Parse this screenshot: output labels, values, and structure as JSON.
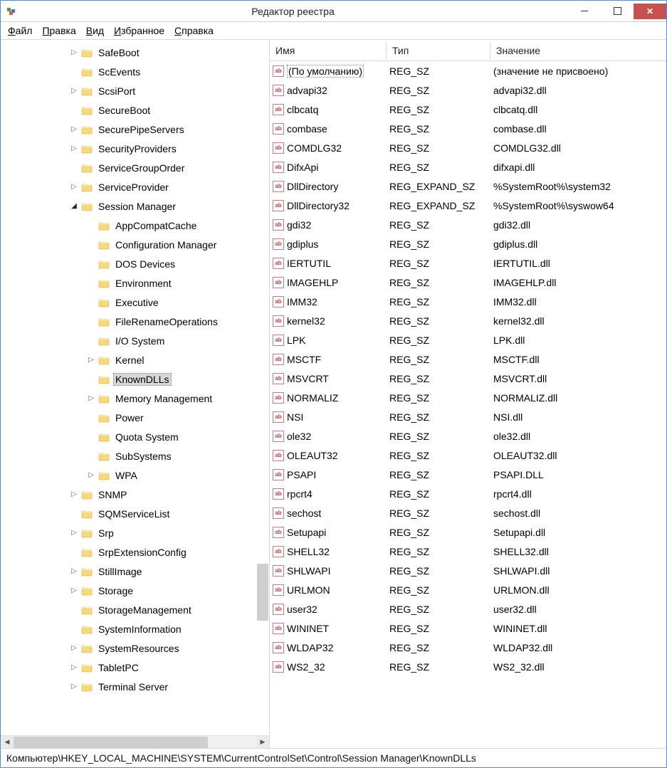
{
  "window": {
    "title": "Редактор реестра"
  },
  "menu": {
    "file": "Файл",
    "edit": "Правка",
    "view": "Вид",
    "favorites": "Избранное",
    "help": "Справка"
  },
  "tree": {
    "items": [
      {
        "indent": 3,
        "exp": "▷",
        "label": "SafeBoot"
      },
      {
        "indent": 3,
        "exp": "",
        "label": "ScEvents"
      },
      {
        "indent": 3,
        "exp": "▷",
        "label": "ScsiPort"
      },
      {
        "indent": 3,
        "exp": "",
        "label": "SecureBoot"
      },
      {
        "indent": 3,
        "exp": "▷",
        "label": "SecurePipeServers"
      },
      {
        "indent": 3,
        "exp": "▷",
        "label": "SecurityProviders"
      },
      {
        "indent": 3,
        "exp": "",
        "label": "ServiceGroupOrder"
      },
      {
        "indent": 3,
        "exp": "▷",
        "label": "ServiceProvider"
      },
      {
        "indent": 3,
        "exp": "◢",
        "label": "Session Manager"
      },
      {
        "indent": 4,
        "exp": "",
        "label": "AppCompatCache"
      },
      {
        "indent": 4,
        "exp": "",
        "label": "Configuration Manager"
      },
      {
        "indent": 4,
        "exp": "",
        "label": "DOS Devices"
      },
      {
        "indent": 4,
        "exp": "",
        "label": "Environment"
      },
      {
        "indent": 4,
        "exp": "",
        "label": "Executive"
      },
      {
        "indent": 4,
        "exp": "",
        "label": "FileRenameOperations"
      },
      {
        "indent": 4,
        "exp": "",
        "label": "I/O System"
      },
      {
        "indent": 4,
        "exp": "▷",
        "label": "Kernel"
      },
      {
        "indent": 4,
        "exp": "",
        "label": "KnownDLLs",
        "selected": true
      },
      {
        "indent": 4,
        "exp": "▷",
        "label": "Memory Management"
      },
      {
        "indent": 4,
        "exp": "",
        "label": "Power"
      },
      {
        "indent": 4,
        "exp": "",
        "label": "Quota System"
      },
      {
        "indent": 4,
        "exp": "",
        "label": "SubSystems"
      },
      {
        "indent": 4,
        "exp": "▷",
        "label": "WPA"
      },
      {
        "indent": 3,
        "exp": "▷",
        "label": "SNMP"
      },
      {
        "indent": 3,
        "exp": "",
        "label": "SQMServiceList"
      },
      {
        "indent": 3,
        "exp": "▷",
        "label": "Srp"
      },
      {
        "indent": 3,
        "exp": "",
        "label": "SrpExtensionConfig"
      },
      {
        "indent": 3,
        "exp": "▷",
        "label": "StillImage"
      },
      {
        "indent": 3,
        "exp": "▷",
        "label": "Storage"
      },
      {
        "indent": 3,
        "exp": "",
        "label": "StorageManagement"
      },
      {
        "indent": 3,
        "exp": "",
        "label": "SystemInformation"
      },
      {
        "indent": 3,
        "exp": "▷",
        "label": "SystemResources"
      },
      {
        "indent": 3,
        "exp": "▷",
        "label": "TabletPC"
      },
      {
        "indent": 3,
        "exp": "▷",
        "label": "Terminal Server"
      }
    ]
  },
  "list": {
    "headers": {
      "name": "Имя",
      "type": "Тип",
      "value": "Значение"
    },
    "rows": [
      {
        "name": "(По умолчанию)",
        "type": "REG_SZ",
        "value": "(значение не присвоено)"
      },
      {
        "name": "advapi32",
        "type": "REG_SZ",
        "value": "advapi32.dll"
      },
      {
        "name": "clbcatq",
        "type": "REG_SZ",
        "value": "clbcatq.dll"
      },
      {
        "name": "combase",
        "type": "REG_SZ",
        "value": "combase.dll"
      },
      {
        "name": "COMDLG32",
        "type": "REG_SZ",
        "value": "COMDLG32.dll"
      },
      {
        "name": "DifxApi",
        "type": "REG_SZ",
        "value": "difxapi.dll"
      },
      {
        "name": "DllDirectory",
        "type": "REG_EXPAND_SZ",
        "value": "%SystemRoot%\\system32"
      },
      {
        "name": "DllDirectory32",
        "type": "REG_EXPAND_SZ",
        "value": "%SystemRoot%\\syswow64"
      },
      {
        "name": "gdi32",
        "type": "REG_SZ",
        "value": "gdi32.dll"
      },
      {
        "name": "gdiplus",
        "type": "REG_SZ",
        "value": "gdiplus.dll"
      },
      {
        "name": "IERTUTIL",
        "type": "REG_SZ",
        "value": "IERTUTIL.dll"
      },
      {
        "name": "IMAGEHLP",
        "type": "REG_SZ",
        "value": "IMAGEHLP.dll"
      },
      {
        "name": "IMM32",
        "type": "REG_SZ",
        "value": "IMM32.dll"
      },
      {
        "name": "kernel32",
        "type": "REG_SZ",
        "value": "kernel32.dll"
      },
      {
        "name": "LPK",
        "type": "REG_SZ",
        "value": "LPK.dll"
      },
      {
        "name": "MSCTF",
        "type": "REG_SZ",
        "value": "MSCTF.dll"
      },
      {
        "name": "MSVCRT",
        "type": "REG_SZ",
        "value": "MSVCRT.dll"
      },
      {
        "name": "NORMALIZ",
        "type": "REG_SZ",
        "value": "NORMALIZ.dll"
      },
      {
        "name": "NSI",
        "type": "REG_SZ",
        "value": "NSI.dll"
      },
      {
        "name": "ole32",
        "type": "REG_SZ",
        "value": "ole32.dll"
      },
      {
        "name": "OLEAUT32",
        "type": "REG_SZ",
        "value": "OLEAUT32.dll"
      },
      {
        "name": "PSAPI",
        "type": "REG_SZ",
        "value": "PSAPI.DLL"
      },
      {
        "name": "rpcrt4",
        "type": "REG_SZ",
        "value": "rpcrt4.dll"
      },
      {
        "name": "sechost",
        "type": "REG_SZ",
        "value": "sechost.dll"
      },
      {
        "name": "Setupapi",
        "type": "REG_SZ",
        "value": "Setupapi.dll"
      },
      {
        "name": "SHELL32",
        "type": "REG_SZ",
        "value": "SHELL32.dll"
      },
      {
        "name": "SHLWAPI",
        "type": "REG_SZ",
        "value": "SHLWAPI.dll"
      },
      {
        "name": "URLMON",
        "type": "REG_SZ",
        "value": "URLMON.dll"
      },
      {
        "name": "user32",
        "type": "REG_SZ",
        "value": "user32.dll"
      },
      {
        "name": "WININET",
        "type": "REG_SZ",
        "value": "WININET.dll"
      },
      {
        "name": "WLDAP32",
        "type": "REG_SZ",
        "value": "WLDAP32.dll"
      },
      {
        "name": "WS2_32",
        "type": "REG_SZ",
        "value": "WS2_32.dll"
      }
    ]
  },
  "statusbar": {
    "path": "Компьютер\\HKEY_LOCAL_MACHINE\\SYSTEM\\CurrentControlSet\\Control\\Session Manager\\KnownDLLs"
  }
}
